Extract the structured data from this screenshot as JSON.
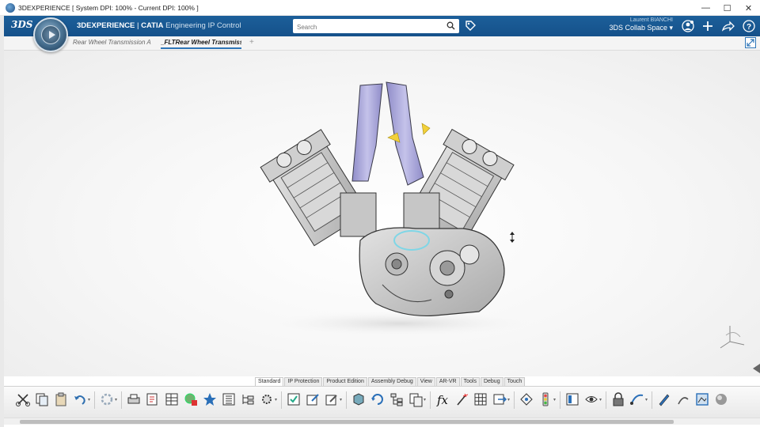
{
  "window": {
    "title": "3DEXPERIENCE [ System DPI: 100% - Current DPI: 100% ]",
    "controls": {
      "minimize": "—",
      "maximize": "☐",
      "close": "✕"
    }
  },
  "header": {
    "logo": "3DS",
    "brand": "3DEXPERIENCE",
    "product": "CATIA",
    "app": "Engineering IP Control",
    "search_placeholder": "Search",
    "user_name": "Laurent BIANCHI",
    "collab_space": "3DS Collab Space ▾"
  },
  "tabs": [
    {
      "label": "Rear Wheel Transmission A"
    },
    {
      "label": "_FLTRear Wheel Transmiss"
    }
  ],
  "tab_add": "+",
  "bottom_tabs": [
    "Standard",
    "IP Protection",
    "Product Edition",
    "Assembly Debug",
    "View",
    "AR-VR",
    "Tools",
    "Debug",
    "Touch"
  ],
  "active_bottom_tab": "Standard",
  "toolbar": {
    "tools": [
      "scissors-icon",
      "copy-icon",
      "paste-icon",
      "undo-icon",
      "gear-icon",
      "printer-icon",
      "properties-icon",
      "table-icon",
      "globe-icon",
      "star-icon",
      "list-icon",
      "tree-icon",
      "settings-icon",
      "check-icon",
      "edit-icon",
      "edit2-icon",
      "cube-icon",
      "refresh-icon",
      "hierarchy-icon",
      "compare-icon",
      "formula-icon",
      "wand-icon",
      "grid-icon",
      "export-icon",
      "geo-icon",
      "traffic-light-icon",
      "panel-icon",
      "view-icon",
      "lock-icon",
      "route-icon",
      "pen-icon",
      "sketch-icon",
      "render-icon",
      "sphere-icon"
    ],
    "formula_label": "fx"
  },
  "colors": {
    "header_blue": "#1c5f9a",
    "engine_purple": "#a8a6d6",
    "engine_grey": "#c9c9c9",
    "highlight_cyan": "#7fd6e6",
    "marker_yellow": "#f2d03a"
  }
}
